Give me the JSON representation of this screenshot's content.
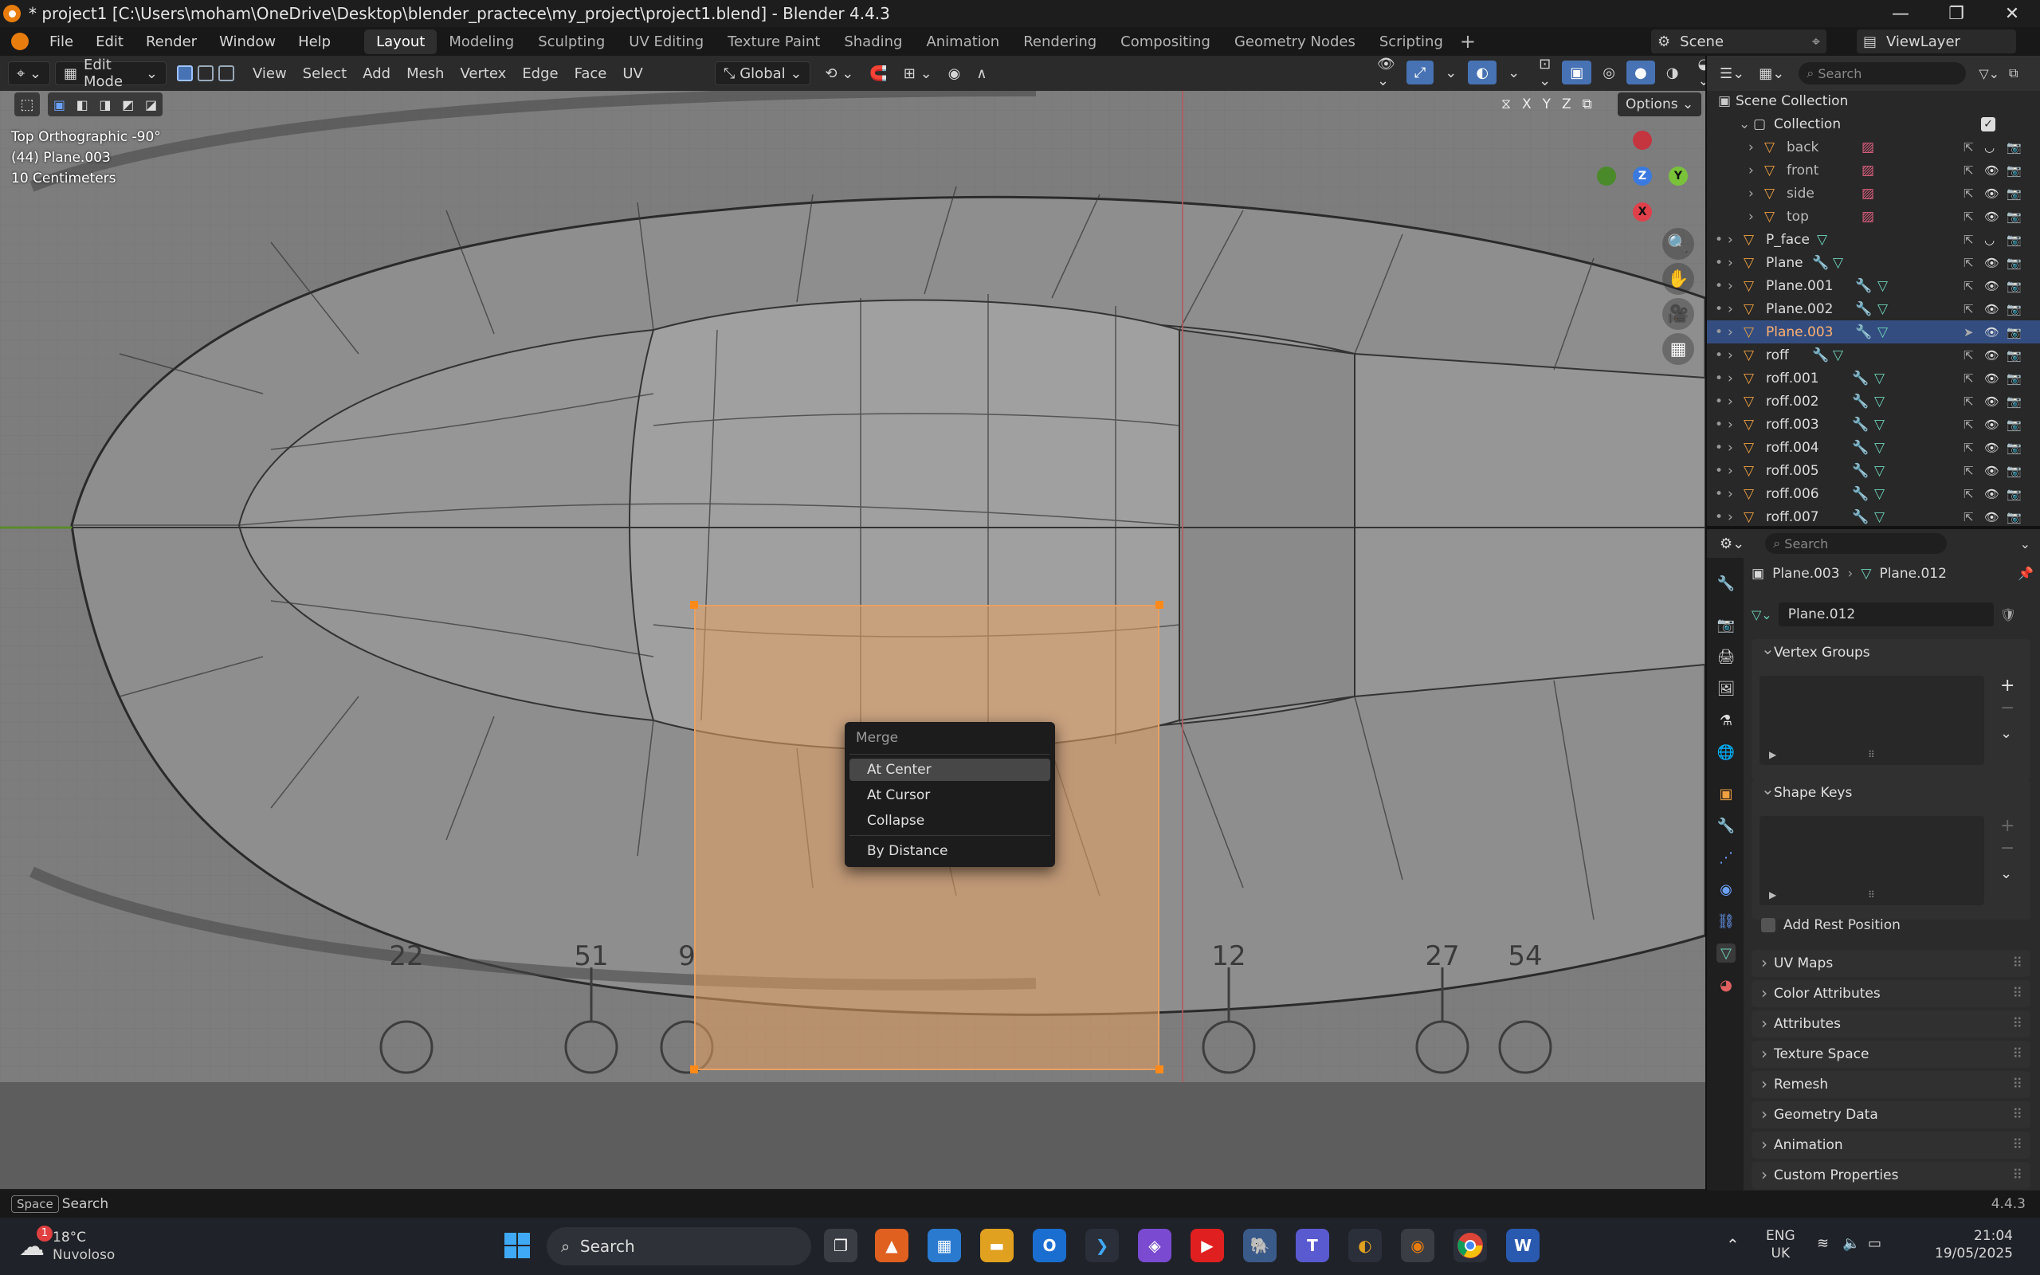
{
  "title_bar": {
    "title": "* project1 [C:\\Users\\moham\\OneDrive\\Desktop\\blender_practece\\my_project\\project1.blend] - Blender 4.4.3"
  },
  "menu": {
    "items": [
      "File",
      "Edit",
      "Render",
      "Window",
      "Help"
    ]
  },
  "workspaces": {
    "tabs": [
      "Layout",
      "Modeling",
      "Sculpting",
      "UV Editing",
      "Texture Paint",
      "Shading",
      "Animation",
      "Rendering",
      "Compositing",
      "Geometry Nodes",
      "Scripting"
    ],
    "active": "Layout"
  },
  "scene": {
    "scene_name": "Scene",
    "view_layer": "ViewLayer"
  },
  "viewport_header": {
    "mode": "Edit Mode",
    "menus": [
      "View",
      "Select",
      "Add",
      "Mesh",
      "Vertex",
      "Edge",
      "Face",
      "UV"
    ],
    "orientation": "Global",
    "axes": [
      "X",
      "Y",
      "Z"
    ],
    "options": "Options"
  },
  "viewport": {
    "view_name": "Top Orthographic -90°",
    "object_info": "(44) Plane.003",
    "scale": "10 Centimeters",
    "blueprint_numbers": [
      "22",
      "51",
      "9",
      "12",
      "27",
      "54"
    ],
    "gizmo": {
      "x": "X",
      "y": "Y",
      "z": "Z"
    }
  },
  "merge_menu": {
    "title": "Merge",
    "items": [
      "At Center",
      "At Cursor",
      "Collapse",
      "By Distance"
    ],
    "highlighted": "At Center"
  },
  "outliner": {
    "search_placeholder": "Search",
    "root": "Scene Collection",
    "collection": "Collection",
    "items": [
      {
        "name": "back",
        "kind": "image"
      },
      {
        "name": "front",
        "kind": "image"
      },
      {
        "name": "side",
        "kind": "image"
      },
      {
        "name": "top",
        "kind": "image"
      },
      {
        "name": "P_face",
        "kind": "mesh"
      },
      {
        "name": "Plane",
        "kind": "mesh"
      },
      {
        "name": "Plane.001",
        "kind": "mesh"
      },
      {
        "name": "Plane.002",
        "kind": "mesh"
      },
      {
        "name": "Plane.003",
        "kind": "mesh",
        "selected": true
      },
      {
        "name": "roff",
        "kind": "mesh"
      },
      {
        "name": "roff.001",
        "kind": "mesh"
      },
      {
        "name": "roff.002",
        "kind": "mesh"
      },
      {
        "name": "roff.003",
        "kind": "mesh"
      },
      {
        "name": "roff.004",
        "kind": "mesh"
      },
      {
        "name": "roff.005",
        "kind": "mesh"
      },
      {
        "name": "roff.006",
        "kind": "mesh"
      },
      {
        "name": "roff.007",
        "kind": "mesh"
      }
    ]
  },
  "properties": {
    "search_placeholder": "Search",
    "breadcrumb_object": "Plane.003",
    "breadcrumb_mesh": "Plane.012",
    "mesh_name": "Plane.012",
    "panels": {
      "vertex_groups": "Vertex Groups",
      "shape_keys": "Shape Keys",
      "add_rest_position": "Add Rest Position",
      "uv_maps": "UV Maps",
      "color_attributes": "Color Attributes",
      "attributes": "Attributes",
      "texture_space": "Texture Space",
      "remesh": "Remesh",
      "geometry_data": "Geometry Data",
      "animation": "Animation",
      "custom_properties": "Custom Properties"
    }
  },
  "status_bar": {
    "key": "Space",
    "action": "Search",
    "version": "4.4.3"
  },
  "taskbar": {
    "weather_temp": "18°C",
    "weather_desc": "Nuvoloso",
    "weather_badge": "1",
    "search": "Search",
    "lang": "ENG",
    "region": "UK",
    "time": "21:04",
    "date": "19/05/2025"
  },
  "colors": {
    "selection_orange": "#e8a062",
    "outliner_selected": "#334d80",
    "accent_blue": "#4772b3"
  }
}
